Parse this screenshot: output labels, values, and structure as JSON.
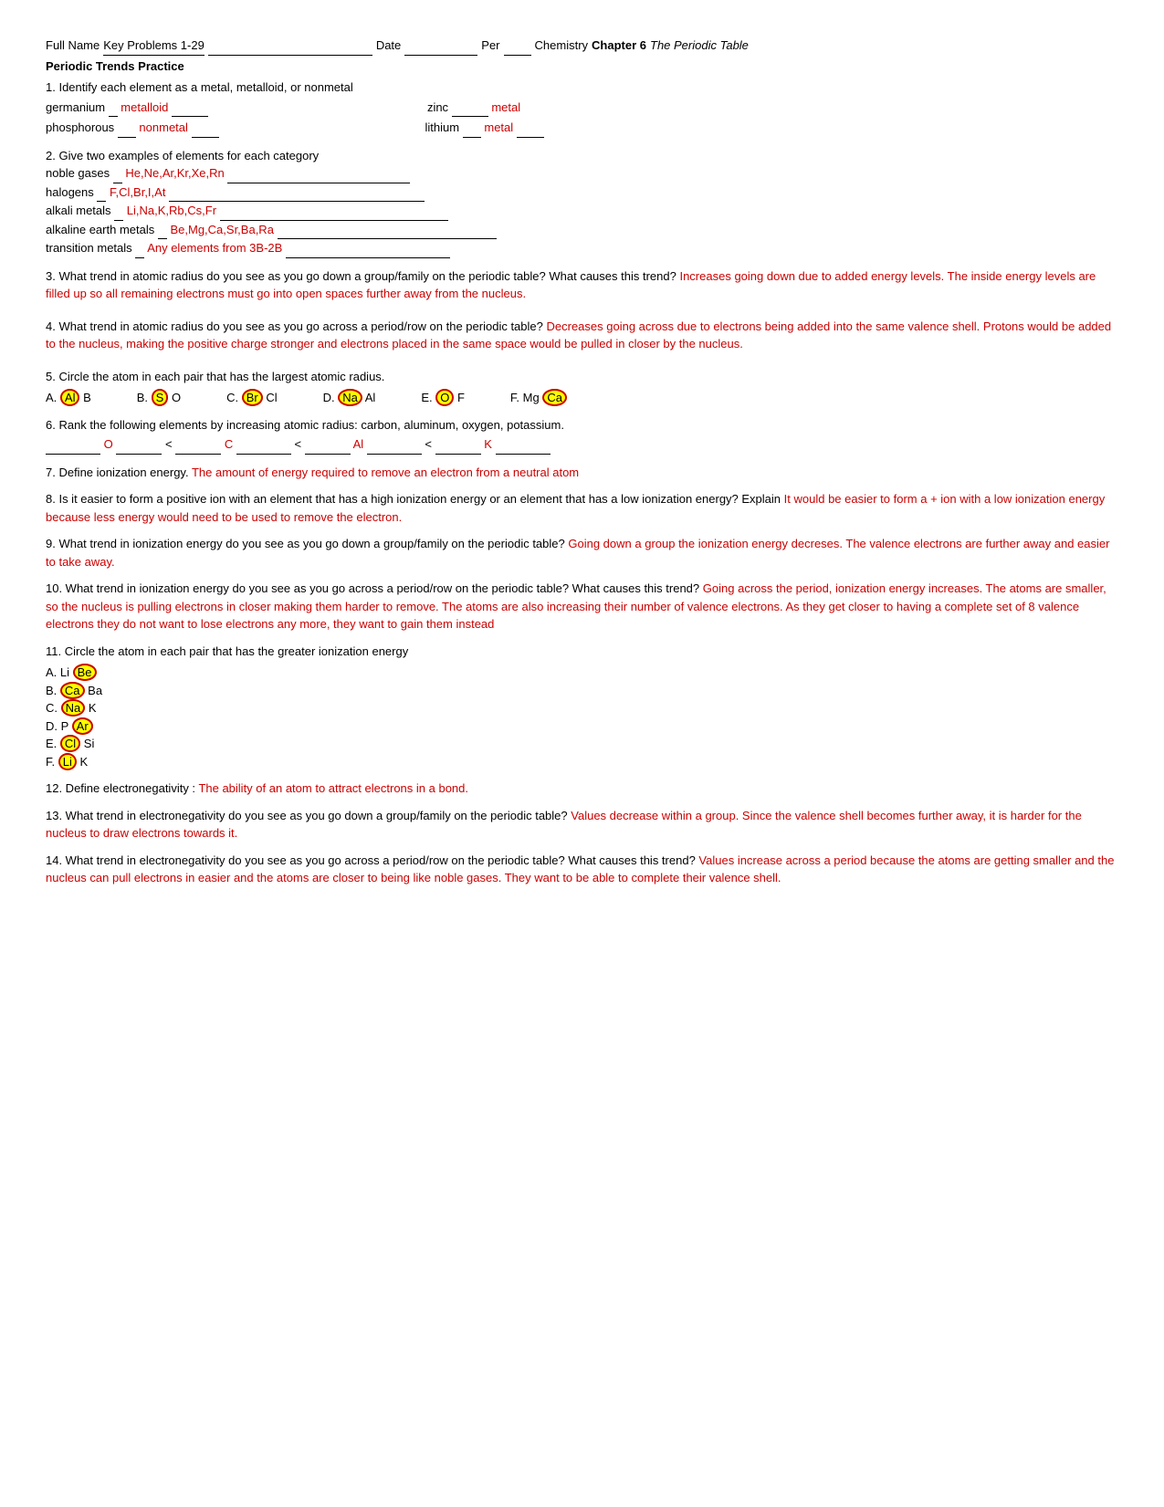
{
  "header": {
    "full_name_label": "Full Name",
    "key_problems": "Key Problems 1-29",
    "date_label": "Date",
    "per_label": "Per",
    "chemistry_label": "Chemistry",
    "chapter_label": "Chapter 6",
    "chapter_title": "The Periodic Table"
  },
  "section_title": "Periodic Trends Practice",
  "questions": {
    "q1": {
      "text": "1. Identify each element as a metal, metalloid, or nonmetal",
      "germanium_label": "germanium",
      "germanium_answer": "metalloid",
      "zinc_label": "zinc",
      "zinc_answer": "metal",
      "phosphorous_label": "phosphorous",
      "phosphorous_answer": "nonmetal",
      "lithium_label": "lithium",
      "lithium_answer": "metal"
    },
    "q2": {
      "text": "2. Give two examples of elements for each category",
      "noble_gases_label": "noble gases",
      "noble_gases_answer": "He,Ne,Ar,Kr,Xe,Rn",
      "halogens_label": "halogens",
      "halogens_answer": "F,Cl,Br,I,At",
      "alkali_metals_label": "alkali metals",
      "alkali_metals_answer": "Li,Na,K,Rb,Cs,Fr",
      "alkaline_label": "alkaline earth metals",
      "alkaline_answer": "Be,Mg,Ca,Sr,Ba,Ra",
      "transition_label": "transition metals",
      "transition_answer": "Any elements from 3B-2B"
    },
    "q3": {
      "text": "3. What trend in atomic radius do you see as you go down a group/family on the periodic table? What causes this trend?",
      "answer": "Increases going down due to added energy levels.  The inside energy levels are filled up so all remaining electrons must go into open spaces further away from the nucleus."
    },
    "q4": {
      "text": "4. What trend in atomic radius do you see as you go across a period/row on the periodic table?",
      "answer": "Decreases going across due to electrons being added into the same valence shell.  Protons would be added to the nucleus, making the positive charge stronger and electrons placed in the same space would be pulled in closer by the nucleus."
    },
    "q5": {
      "text": "5. Circle the atom in each pair that has the largest atomic radius.",
      "a_label": "A.",
      "a_circled": "Al",
      "a_other": "B",
      "b_label": "B.",
      "b_circled": "S",
      "b_other": "O",
      "c_label": "C.",
      "c_circled": "Br",
      "c_other": "Cl",
      "d_label": "D.",
      "d_circled": "Na",
      "d_other": "Al",
      "e_label": "E.",
      "e_circled": "O",
      "e_other": "F",
      "f_label": "F. Mg",
      "f_circled": "Ca"
    },
    "q6": {
      "text": "6. Rank the following elements by increasing atomic radius: carbon, aluminum, oxygen, potassium.",
      "answer": "_________O_________<__________C___________<__________Al___________<_________K__________"
    },
    "q7": {
      "text": "7. Define ionization energy.",
      "answer": "The amount of energy required to remove an electron from a neutral atom"
    },
    "q8": {
      "text": "8. Is it easier to form a positive ion with an element that has a high ionization energy or an element that has a low ionization energy? Explain",
      "answer": "It would be easier to form a + ion with a low ionization energy because less energy would need to be used to remove the electron."
    },
    "q9": {
      "text": "9. What trend in ionization energy do you see as you go down a group/family on the periodic table?",
      "answer": "Going down a group the ionization energy decreses.  The valence electrons are further away and easier to take away."
    },
    "q10": {
      "text": "10. What trend in ionization energy do you see as you go across a period/row on the periodic table? What causes this trend?",
      "answer": "Going across the period, ionization energy increases.  The atoms are smaller, so the nucleus is pulling electrons in closer making them harder to remove.  The atoms are also increasing their number of valence electrons.  As they get closer to having a complete set of 8 valence electrons they do not want to lose electrons any more, they want to gain them instead"
    },
    "q11": {
      "text": "11. Circle the atom in each pair that has the greater ionization energy",
      "a": "A. Li",
      "a_circled": "Be",
      "b": "B.",
      "b_circled": "Ca",
      "b_other": "Ba",
      "c": "C.",
      "c_circled": "Na",
      "c_other": "K",
      "d": "D. P",
      "d_circled": "Ar",
      "e": "E.",
      "e_circled": "Cl",
      "e_other": "Si",
      "f": "F.",
      "f_circled": "Li",
      "f_other": "K"
    },
    "q12": {
      "text": "12. Define electronegativity :",
      "answer": "The ability of an atom to attract electrons in a bond."
    },
    "q13": {
      "text": "13. What trend in electronegativity do you see as you go down a group/family on the periodic table?",
      "answer": "Values decrease within a group.  Since the valence shell becomes further away, it is harder for the nucleus to draw electrons towards it."
    },
    "q14": {
      "text": "14. What trend in electronegativity do you see as you go across a period/row on the periodic table? What causes this trend?",
      "answer": "Values increase across a period because the atoms are getting smaller and the nucleus can pull electrons in easier and the atoms are closer to being like noble gases.  They want to be able to complete their valence shell."
    }
  }
}
